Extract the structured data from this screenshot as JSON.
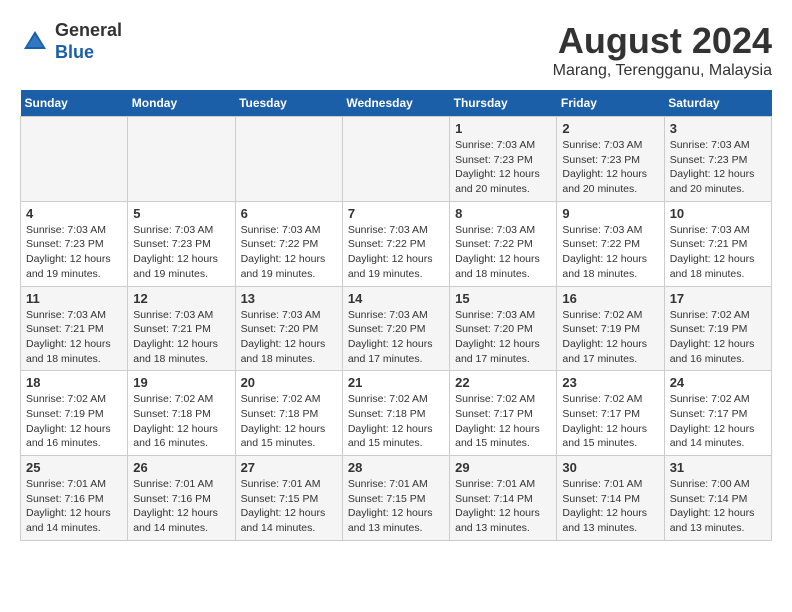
{
  "header": {
    "logo_line1": "General",
    "logo_line2": "Blue",
    "main_title": "August 2024",
    "sub_title": "Marang, Terengganu, Malaysia"
  },
  "calendar": {
    "days_of_week": [
      "Sunday",
      "Monday",
      "Tuesday",
      "Wednesday",
      "Thursday",
      "Friday",
      "Saturday"
    ],
    "weeks": [
      [
        {
          "day": "",
          "info": ""
        },
        {
          "day": "",
          "info": ""
        },
        {
          "day": "",
          "info": ""
        },
        {
          "day": "",
          "info": ""
        },
        {
          "day": "1",
          "info": "Sunrise: 7:03 AM\nSunset: 7:23 PM\nDaylight: 12 hours\nand 20 minutes."
        },
        {
          "day": "2",
          "info": "Sunrise: 7:03 AM\nSunset: 7:23 PM\nDaylight: 12 hours\nand 20 minutes."
        },
        {
          "day": "3",
          "info": "Sunrise: 7:03 AM\nSunset: 7:23 PM\nDaylight: 12 hours\nand 20 minutes."
        }
      ],
      [
        {
          "day": "4",
          "info": "Sunrise: 7:03 AM\nSunset: 7:23 PM\nDaylight: 12 hours\nand 19 minutes."
        },
        {
          "day": "5",
          "info": "Sunrise: 7:03 AM\nSunset: 7:23 PM\nDaylight: 12 hours\nand 19 minutes."
        },
        {
          "day": "6",
          "info": "Sunrise: 7:03 AM\nSunset: 7:22 PM\nDaylight: 12 hours\nand 19 minutes."
        },
        {
          "day": "7",
          "info": "Sunrise: 7:03 AM\nSunset: 7:22 PM\nDaylight: 12 hours\nand 19 minutes."
        },
        {
          "day": "8",
          "info": "Sunrise: 7:03 AM\nSunset: 7:22 PM\nDaylight: 12 hours\nand 18 minutes."
        },
        {
          "day": "9",
          "info": "Sunrise: 7:03 AM\nSunset: 7:22 PM\nDaylight: 12 hours\nand 18 minutes."
        },
        {
          "day": "10",
          "info": "Sunrise: 7:03 AM\nSunset: 7:21 PM\nDaylight: 12 hours\nand 18 minutes."
        }
      ],
      [
        {
          "day": "11",
          "info": "Sunrise: 7:03 AM\nSunset: 7:21 PM\nDaylight: 12 hours\nand 18 minutes."
        },
        {
          "day": "12",
          "info": "Sunrise: 7:03 AM\nSunset: 7:21 PM\nDaylight: 12 hours\nand 18 minutes."
        },
        {
          "day": "13",
          "info": "Sunrise: 7:03 AM\nSunset: 7:20 PM\nDaylight: 12 hours\nand 18 minutes."
        },
        {
          "day": "14",
          "info": "Sunrise: 7:03 AM\nSunset: 7:20 PM\nDaylight: 12 hours\nand 17 minutes."
        },
        {
          "day": "15",
          "info": "Sunrise: 7:03 AM\nSunset: 7:20 PM\nDaylight: 12 hours\nand 17 minutes."
        },
        {
          "day": "16",
          "info": "Sunrise: 7:02 AM\nSunset: 7:19 PM\nDaylight: 12 hours\nand 17 minutes."
        },
        {
          "day": "17",
          "info": "Sunrise: 7:02 AM\nSunset: 7:19 PM\nDaylight: 12 hours\nand 16 minutes."
        }
      ],
      [
        {
          "day": "18",
          "info": "Sunrise: 7:02 AM\nSunset: 7:19 PM\nDaylight: 12 hours\nand 16 minutes."
        },
        {
          "day": "19",
          "info": "Sunrise: 7:02 AM\nSunset: 7:18 PM\nDaylight: 12 hours\nand 16 minutes."
        },
        {
          "day": "20",
          "info": "Sunrise: 7:02 AM\nSunset: 7:18 PM\nDaylight: 12 hours\nand 15 minutes."
        },
        {
          "day": "21",
          "info": "Sunrise: 7:02 AM\nSunset: 7:18 PM\nDaylight: 12 hours\nand 15 minutes."
        },
        {
          "day": "22",
          "info": "Sunrise: 7:02 AM\nSunset: 7:17 PM\nDaylight: 12 hours\nand 15 minutes."
        },
        {
          "day": "23",
          "info": "Sunrise: 7:02 AM\nSunset: 7:17 PM\nDaylight: 12 hours\nand 15 minutes."
        },
        {
          "day": "24",
          "info": "Sunrise: 7:02 AM\nSunset: 7:17 PM\nDaylight: 12 hours\nand 14 minutes."
        }
      ],
      [
        {
          "day": "25",
          "info": "Sunrise: 7:01 AM\nSunset: 7:16 PM\nDaylight: 12 hours\nand 14 minutes."
        },
        {
          "day": "26",
          "info": "Sunrise: 7:01 AM\nSunset: 7:16 PM\nDaylight: 12 hours\nand 14 minutes."
        },
        {
          "day": "27",
          "info": "Sunrise: 7:01 AM\nSunset: 7:15 PM\nDaylight: 12 hours\nand 14 minutes."
        },
        {
          "day": "28",
          "info": "Sunrise: 7:01 AM\nSunset: 7:15 PM\nDaylight: 12 hours\nand 13 minutes."
        },
        {
          "day": "29",
          "info": "Sunrise: 7:01 AM\nSunset: 7:14 PM\nDaylight: 12 hours\nand 13 minutes."
        },
        {
          "day": "30",
          "info": "Sunrise: 7:01 AM\nSunset: 7:14 PM\nDaylight: 12 hours\nand 13 minutes."
        },
        {
          "day": "31",
          "info": "Sunrise: 7:00 AM\nSunset: 7:14 PM\nDaylight: 12 hours\nand 13 minutes."
        }
      ]
    ]
  }
}
